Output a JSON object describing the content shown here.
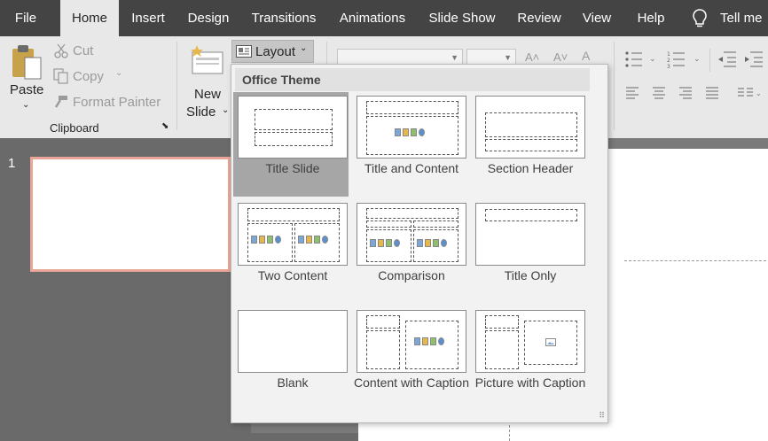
{
  "tabs": [
    {
      "label": "File",
      "active": false
    },
    {
      "label": "Home",
      "active": true
    },
    {
      "label": "Insert",
      "active": false
    },
    {
      "label": "Design",
      "active": false
    },
    {
      "label": "Transitions",
      "active": false
    },
    {
      "label": "Animations",
      "active": false
    },
    {
      "label": "Slide Show",
      "active": false
    },
    {
      "label": "Review",
      "active": false
    },
    {
      "label": "View",
      "active": false
    },
    {
      "label": "Help",
      "active": false
    }
  ],
  "tell_me": "Tell me",
  "clipboard": {
    "paste": "Paste",
    "cut": "Cut",
    "copy": "Copy",
    "format_painter": "Format Painter",
    "group_label": "Clipboard"
  },
  "slides": {
    "new_slide_line1": "New",
    "new_slide_line2": "Slide",
    "layout_button": "Layout"
  },
  "slide_number": "1",
  "layout_menu": {
    "header": "Office Theme",
    "items": [
      {
        "label": "Title Slide",
        "selected": true
      },
      {
        "label": "Title and Content",
        "selected": false
      },
      {
        "label": "Section Header",
        "selected": false
      },
      {
        "label": "Two Content",
        "selected": false
      },
      {
        "label": "Comparison",
        "selected": false
      },
      {
        "label": "Title Only",
        "selected": false
      },
      {
        "label": "Blank",
        "selected": false
      },
      {
        "label": "Content with Caption",
        "selected": false
      },
      {
        "label": "Picture with Caption",
        "selected": false
      }
    ]
  },
  "colors": {
    "tabbar": "#444444",
    "ribbon": "#e8e8e8",
    "selected_item": "#a6a6a6",
    "thumb_border": "#e8a598"
  }
}
